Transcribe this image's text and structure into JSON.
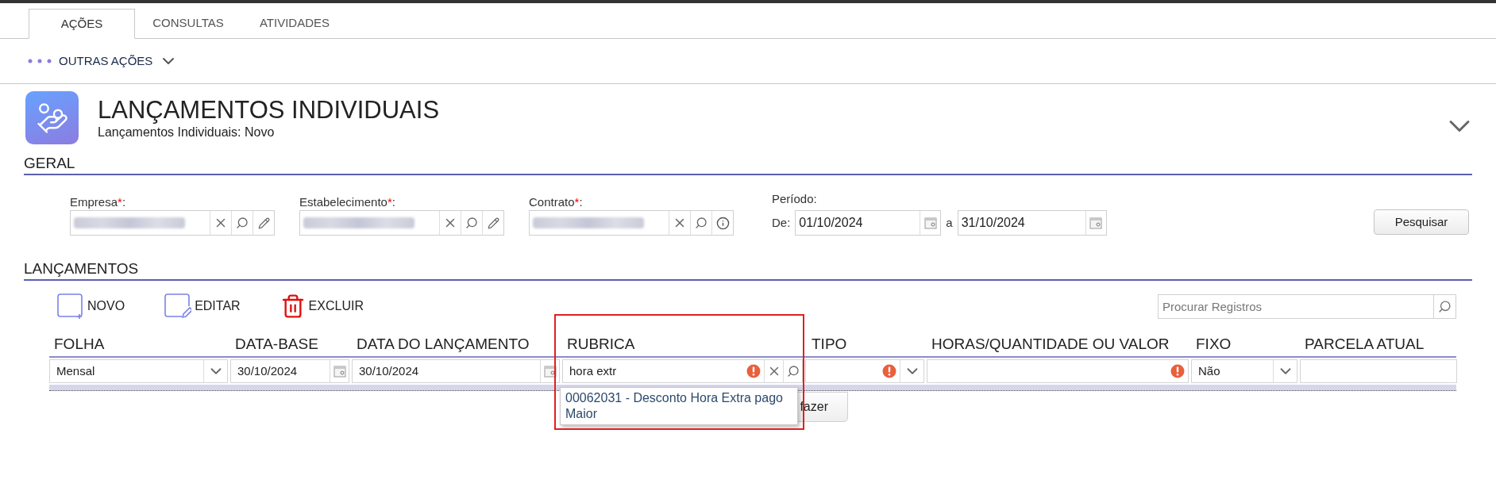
{
  "tabs": [
    {
      "label": "AÇÕES",
      "selected": true
    },
    {
      "label": "CONSULTAS",
      "selected": false
    },
    {
      "label": "ATIVIDADES",
      "selected": false
    }
  ],
  "actions_menu": {
    "label": "OUTRAS AÇÕES"
  },
  "header": {
    "title": "LANÇAMENTOS INDIVIDUAIS",
    "subtitle": "Lançamentos Individuais: Novo"
  },
  "geral": {
    "title": "GERAL",
    "fields": [
      {
        "label": "Empresa",
        "required_mark": "*",
        "label_end": ":",
        "kind": "edit"
      },
      {
        "label": "Estabelecimento",
        "required_mark": "*",
        "label_end": ":",
        "kind": "edit"
      },
      {
        "label": "Contrato",
        "required_mark": "*",
        "label_end": ":",
        "kind": "info"
      }
    ],
    "period": {
      "label": "Período:",
      "from_label": "De:",
      "from": "01/10/2024",
      "to_label": "a",
      "to": "31/10/2024"
    },
    "search_button": "Pesquisar"
  },
  "lancamentos": {
    "title": "LANÇAMENTOS",
    "toolbar": [
      {
        "label": "NOVO",
        "kind": "new"
      },
      {
        "label": "EDITAR",
        "kind": "edit"
      },
      {
        "label": "EXCLUIR",
        "kind": "delete"
      }
    ],
    "search": {
      "placeholder": "Procurar Registros"
    },
    "columns": [
      "FOLHA",
      "DATA-BASE",
      "DATA DO LANÇAMENTO",
      "RUBRICA",
      "TIPO",
      "HORAS/QUANTIDADE OU VALOR",
      "FIXO",
      "PARCELA ATUAL"
    ],
    "row": [
      {
        "kind": "select",
        "value": "Mensal",
        "error": false
      },
      {
        "kind": "date",
        "value": "30/10/2024",
        "error": false
      },
      {
        "kind": "date",
        "value": "30/10/2024",
        "error": false
      },
      {
        "kind": "lookup",
        "value": "hora extr",
        "error": true
      },
      {
        "kind": "select",
        "error": true
      },
      {
        "kind": "text",
        "error": true
      },
      {
        "kind": "select",
        "value": "Não",
        "error": false
      },
      {
        "kind": "text",
        "error": false
      }
    ],
    "suggestion": "00062031 - Desconto Hora Extra pago Maior",
    "partial_button": "fazer"
  }
}
